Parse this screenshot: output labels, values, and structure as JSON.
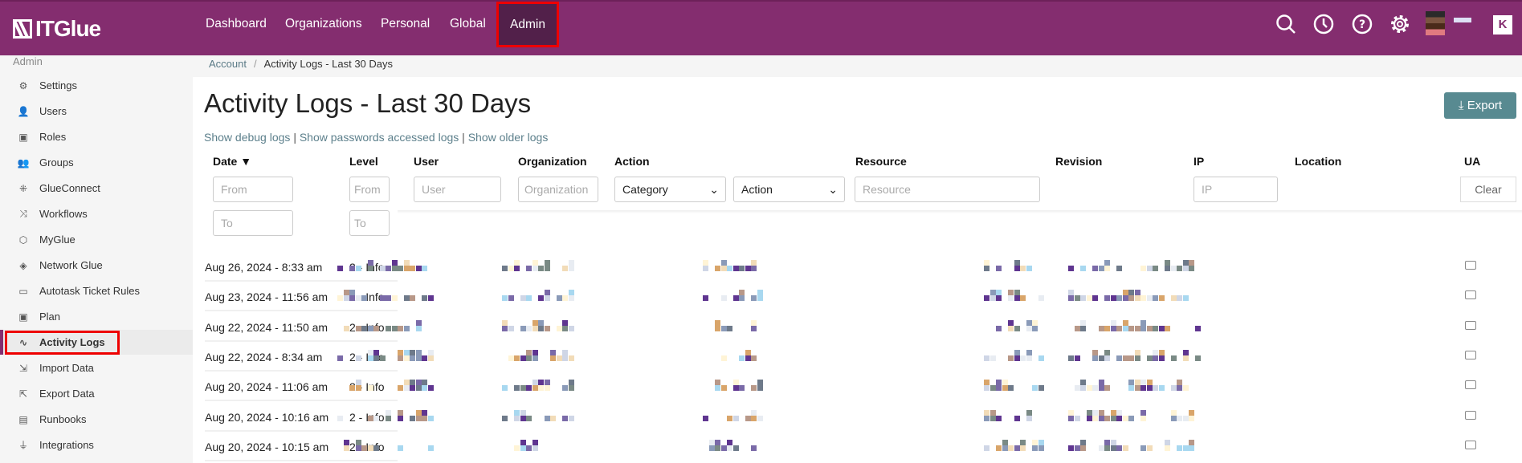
{
  "header": {
    "logo": "ITGlue",
    "nav": [
      "Dashboard",
      "Organizations",
      "Personal",
      "Global",
      "Admin"
    ],
    "active_nav": "Admin",
    "icons": [
      "search-icon",
      "clock-icon",
      "help-icon",
      "gear-icon",
      "avatar",
      "kaseya-icon"
    ],
    "brand_color": "#842d6f",
    "kbox": "K"
  },
  "sidebar": {
    "heading": "Admin",
    "items": [
      {
        "label": "Settings",
        "icon": "⚙"
      },
      {
        "label": "Users",
        "icon": "👤"
      },
      {
        "label": "Roles",
        "icon": "▣"
      },
      {
        "label": "Groups",
        "icon": "👥"
      },
      {
        "label": "GlueConnect",
        "icon": "⁜"
      },
      {
        "label": "Workflows",
        "icon": "⤨"
      },
      {
        "label": "MyGlue",
        "icon": "⬡"
      },
      {
        "label": "Network Glue",
        "icon": "◈"
      },
      {
        "label": "Autotask Ticket Rules",
        "icon": "▭"
      },
      {
        "label": "Plan",
        "icon": "▣"
      },
      {
        "label": "Activity Logs",
        "icon": "∿"
      },
      {
        "label": "Import Data",
        "icon": "⇲"
      },
      {
        "label": "Export Data",
        "icon": "⇱"
      },
      {
        "label": "Runbooks",
        "icon": "▤"
      },
      {
        "label": "Integrations",
        "icon": "⏚"
      }
    ],
    "active": "Activity Logs"
  },
  "breadcrumb": {
    "parent": "Account",
    "separator": "/",
    "current": "Activity Logs - Last 30 Days"
  },
  "page": {
    "title": "Activity Logs - Last 30 Days",
    "export_label": "Export",
    "links": [
      "Show debug logs",
      "Show passwords accessed logs",
      "Show older logs"
    ],
    "link_sep": "|"
  },
  "table": {
    "headers": {
      "date": "Date ▼",
      "level": "Level",
      "user": "User",
      "organization": "Organization",
      "action": "Action",
      "resource": "Resource",
      "revision": "Revision",
      "ip": "IP",
      "location": "Location",
      "ua": "UA"
    },
    "filters": {
      "date_from": "From",
      "date_to": "To",
      "level_from": "From",
      "level_to": "To",
      "user": "User",
      "organization": "Organization",
      "category": "Category",
      "action": "Action",
      "resource": "Resource",
      "ip": "IP",
      "clear": "Clear"
    },
    "rows": [
      {
        "date": "Aug 26, 2024 - 8:33 am",
        "level": "2 - Info"
      },
      {
        "date": "Aug 23, 2024 - 11:56 am",
        "level": "2 - Info"
      },
      {
        "date": "Aug 22, 2024 - 11:50 am",
        "level": "2 - Info"
      },
      {
        "date": "Aug 22, 2024 - 8:34 am",
        "level": "2 - Info"
      },
      {
        "date": "Aug 20, 2024 - 11:06 am",
        "level": "2 - Info"
      },
      {
        "date": "Aug 20, 2024 - 10:16 am",
        "level": "2 - Info"
      },
      {
        "date": "Aug 20, 2024 - 10:15 am",
        "level": "2 - Info"
      }
    ]
  }
}
